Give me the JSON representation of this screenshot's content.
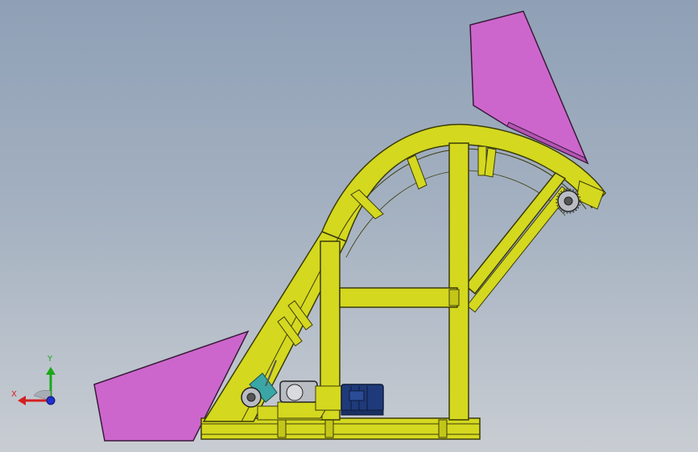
{
  "viewport": {
    "background_top": "#8fa0b6",
    "background_bottom": "#c9cdd3"
  },
  "colors": {
    "frame": "#d4d81f",
    "frame_stroke": "#3b3b0a",
    "hopper": "#cc66cc",
    "hopper_stroke": "#3a1a3a",
    "motor": "#1f3a7a",
    "gearbox": "#3aa6a6",
    "machinery": "#b9bcc2"
  },
  "triad": {
    "x_label": "X",
    "y_label": "Y",
    "x_color": "#d42020",
    "y_color": "#1aa81a",
    "z_color": "#2030d0"
  }
}
